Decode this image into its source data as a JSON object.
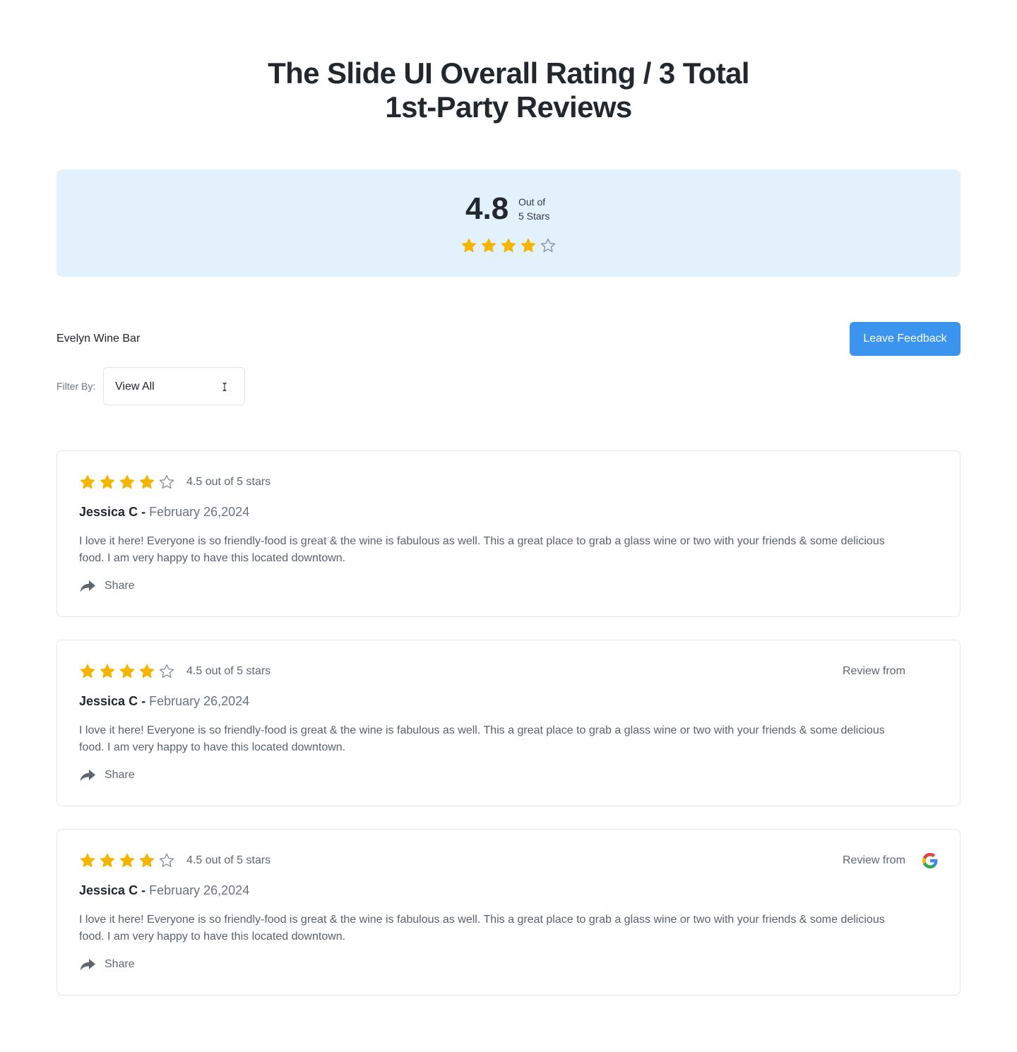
{
  "header": {
    "title_line1": "The Slide UI Overall Rating / 3 Total",
    "title_line2": "1st-Party Reviews"
  },
  "summary": {
    "score": "4.8",
    "out_of_line1": "Out of",
    "out_of_line2": "5 Stars",
    "stars_filled": 4,
    "stars_total": 5
  },
  "business": {
    "name": "Evelyn Wine Bar"
  },
  "actions": {
    "leave_feedback_label": "Leave Feedback"
  },
  "filter": {
    "label": "Filter By:",
    "value": "View All"
  },
  "reviews": [
    {
      "stars_filled": 4,
      "rating_text": "4.5 out of 5 stars",
      "review_from_label": "",
      "author": "Jessica C",
      "separator": "-",
      "date": "February 26,2024",
      "body": "I love it here! Everyone is so friendly-food is great & the wine is fabulous as well. This a great place to grab a glass wine or two with your friends & some delicious food. I am very happy to have this located downtown.",
      "share_label": "Share"
    },
    {
      "stars_filled": 4,
      "rating_text": "4.5 out of 5 stars",
      "review_from_label": "Review from",
      "author": "Jessica C",
      "separator": "-",
      "date": "February 26,2024",
      "body": "I love it here! Everyone is so friendly-food is great & the wine is fabulous as well. This a great place to grab a glass wine or two with your friends & some delicious food. I am very happy to have this located downtown.",
      "share_label": "Share"
    },
    {
      "stars_filled": 4,
      "rating_text": "4.5 out of 5 stars",
      "review_from_label": "Review from",
      "source_icon": "google-icon",
      "author": "Jessica C",
      "separator": "-",
      "date": "February 26,2024",
      "body": "I love it here! Everyone is so friendly-food is great & the wine is fabulous as well. This a great place to grab a glass wine or two with your friends & some delicious food. I am very happy to have this located downtown.",
      "share_label": "Share"
    }
  ],
  "colors": {
    "accent_button": "#3b94ee",
    "summary_background": "#e3f1fd",
    "star_filled": "#f5b400",
    "star_empty": "#8c939b"
  },
  "icons": {
    "star_filled": "star-filled-icon",
    "star_empty": "star-empty-icon",
    "share": "share-arrow-icon",
    "filter_select": "sort-arrows-icon",
    "review_source": "google-icon"
  }
}
